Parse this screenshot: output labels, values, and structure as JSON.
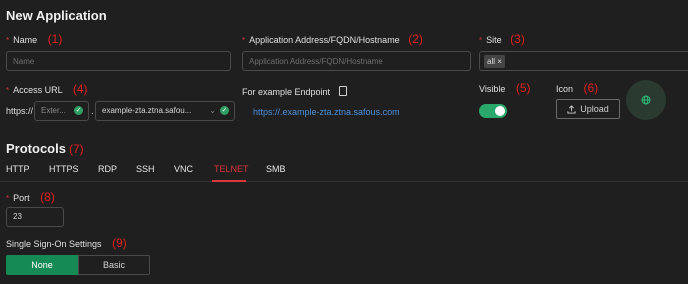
{
  "page_title": "New Application",
  "fields": {
    "name": {
      "required": "*",
      "label": "Name",
      "number": "(1)",
      "value": "",
      "placeholder": "Name"
    },
    "address": {
      "required": "*",
      "label": "Application Address/FQDN/Hostname",
      "number": "(2)",
      "value": "",
      "placeholder": "Application Address/FQDN/Hostname"
    },
    "site": {
      "required": "*",
      "label": "Site",
      "number": "(3)",
      "tag": "all",
      "tag_close": "×"
    },
    "access_url": {
      "required": "*",
      "label": "Access URL",
      "number": "(4)",
      "prefix": "https://",
      "subdomain_placeholder": "Exter...",
      "separator": ".",
      "domain": "example-zta.ztna.safou..."
    },
    "endpoint": {
      "label": "For example Endpoint",
      "value": "https://.example-zta.ztna.safous.com"
    },
    "visible": {
      "label": "Visible",
      "number": "(5)",
      "on": true
    },
    "icon": {
      "label": "Icon",
      "number": "(6)",
      "upload_label": "Upload"
    }
  },
  "protocols": {
    "title": "Protocols",
    "number": "(7)",
    "tabs": [
      "HTTP",
      "HTTPS",
      "RDP",
      "SSH",
      "VNC",
      "TELNET",
      "SMB"
    ],
    "active": "TELNET"
  },
  "port": {
    "required": "*",
    "label": "Port",
    "number": "(8)",
    "value": "23"
  },
  "sso": {
    "label": "Single Sign-On Settings",
    "number": "(9)",
    "options": [
      "None",
      "Basic"
    ],
    "selected": "None"
  },
  "colors": {
    "accent": "#d9363e",
    "toggle_on": "#2aa86b",
    "link": "#4a90d9",
    "annotation": "#e0201b"
  }
}
